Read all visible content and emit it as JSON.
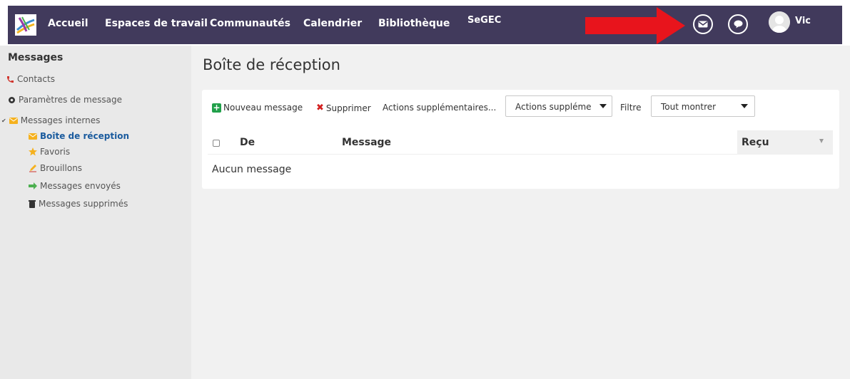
{
  "nav": {
    "items": [
      "Accueil",
      "Espaces de travail",
      "Communautés",
      "Calendrier",
      "Bibliothèque",
      "SeGEC"
    ],
    "user_name": "Vic"
  },
  "icons": {
    "logo": "app-logo",
    "mail": "envelope-icon",
    "chat": "chat-bubble-icon",
    "avatar": "user-avatar",
    "arrow": "red-arrow"
  },
  "colors": {
    "nav_bg": "#413a5c",
    "arrow": "#e8141c",
    "active_link": "#1a5b9e",
    "new_message_icon": "#21a04a",
    "delete_icon": "#d32020"
  },
  "sidebar": {
    "title": "Messages",
    "items": [
      {
        "label": "Contacts",
        "icon": "phone-icon"
      },
      {
        "label": "Paramètres de message",
        "icon": "gear-icon"
      },
      {
        "label": "Messages internes",
        "icon": "envelope-icon"
      },
      {
        "label": "Boîte de réception",
        "icon": "envelope-icon",
        "active": true
      },
      {
        "label": "Favoris",
        "icon": "star-icon"
      },
      {
        "label": "Brouillons",
        "icon": "pencil-icon"
      },
      {
        "label": "Messages envoyés",
        "icon": "arrow-right-icon"
      },
      {
        "label": "Messages supprimés",
        "icon": "trash-icon"
      }
    ]
  },
  "main": {
    "title": "Boîte de réception",
    "toolbar": {
      "new_message": "Nouveau message",
      "delete": "Supprimer",
      "more_actions": "Actions supplémentaires...",
      "actions_select": "Actions suppléme",
      "filter_label": "Filtre",
      "filter_select": "Tout montrer"
    },
    "table": {
      "columns": [
        "De",
        "Message",
        "Reçu"
      ],
      "empty_text": "Aucun message"
    }
  }
}
